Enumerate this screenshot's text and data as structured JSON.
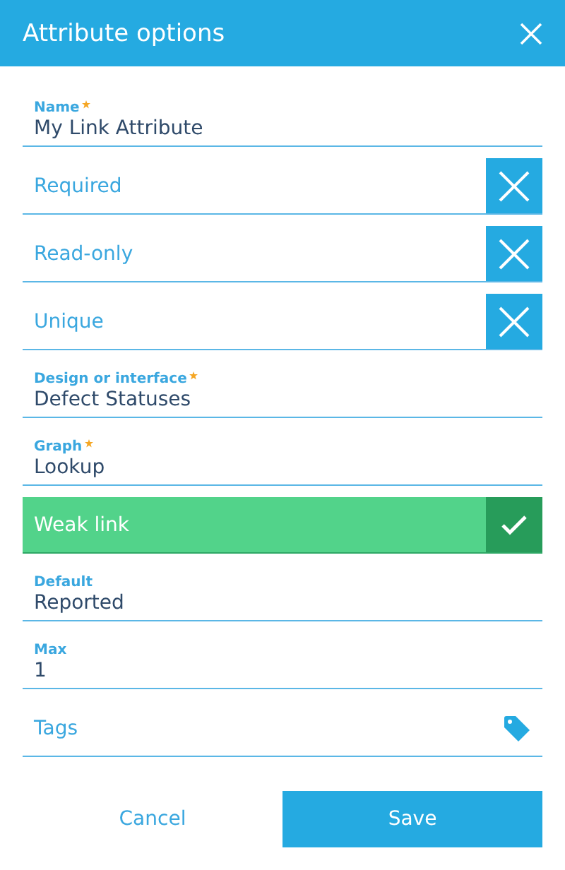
{
  "dialog": {
    "title": "Attribute options"
  },
  "items": [
    {
      "kind": "field",
      "label": "Name",
      "required": true,
      "value": "My Link Attribute"
    },
    {
      "kind": "toggle",
      "label": "Required",
      "checked": false
    },
    {
      "kind": "toggle",
      "label": "Read-only",
      "checked": false
    },
    {
      "kind": "toggle",
      "label": "Unique",
      "checked": false
    },
    {
      "kind": "field",
      "label": "Design or interface",
      "required": true,
      "value": "Defect Statuses"
    },
    {
      "kind": "field",
      "label": "Graph",
      "required": true,
      "value": "Lookup"
    },
    {
      "kind": "toggle",
      "label": "Weak link",
      "checked": true
    },
    {
      "kind": "field",
      "label": "Default",
      "required": false,
      "value": "Reported"
    },
    {
      "kind": "field",
      "label": "Max",
      "required": false,
      "value": "1"
    },
    {
      "kind": "tags",
      "label": "Tags"
    }
  ],
  "buttons": {
    "cancel": "Cancel",
    "save": "Save"
  }
}
